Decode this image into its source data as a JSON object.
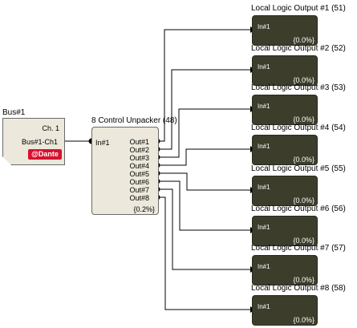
{
  "bus": {
    "title": "Bus#1",
    "channel": "Ch. 1",
    "port": "Bus#1-Ch1",
    "badge": "@Dante"
  },
  "unpacker": {
    "title": "8 Control Unpacker (48)",
    "input": "In#1",
    "outputs": [
      "Out#1",
      "Out#2",
      "Out#3",
      "Out#4",
      "Out#5",
      "Out#6",
      "Out#7",
      "Out#8"
    ],
    "status": "{0.2%}"
  },
  "logic_outputs": [
    {
      "title": "Local Logic Output #1 (51)",
      "input": "In#1",
      "status": "{0.0%}"
    },
    {
      "title": "Local Logic Output #2 (52)",
      "input": "In#1",
      "status": "{0.0%}"
    },
    {
      "title": "Local Logic Output #3 (53)",
      "input": "In#1",
      "status": "{0.0%}"
    },
    {
      "title": "Local Logic Output #4 (54)",
      "input": "In#1",
      "status": "{0.0%}"
    },
    {
      "title": "Local Logic Output #5 (55)",
      "input": "In#1",
      "status": "{0.0%}"
    },
    {
      "title": "Local Logic Output #6 (56)",
      "input": "In#1",
      "status": "{0.0%}"
    },
    {
      "title": "Local Logic Output #7 (57)",
      "input": "In#1",
      "status": "{0.0%}"
    },
    {
      "title": "Local Logic Output #8 (58)",
      "input": "In#1",
      "status": "{0.0%}"
    }
  ],
  "colors": {
    "wire": "#000000",
    "block_light": "#ece8db",
    "block_dark": "#3d3d2c",
    "dante_badge": "#d8102e"
  }
}
